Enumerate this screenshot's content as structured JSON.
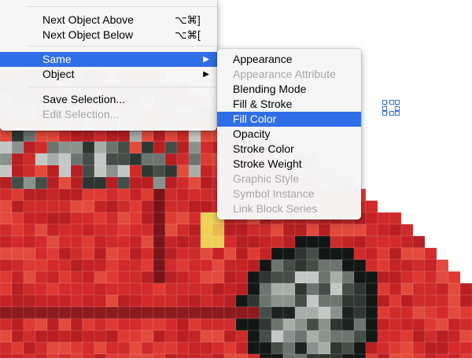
{
  "main_menu": {
    "items": [
      {
        "label": "Next Object Above",
        "shortcut": "⌥⌘]"
      },
      {
        "label": "Next Object Below",
        "shortcut": "⌥⌘["
      },
      {
        "label": "Same",
        "submenu": true,
        "highlighted": true
      },
      {
        "label": "Object",
        "submenu": true
      },
      {
        "label": "Save Selection..."
      },
      {
        "label": "Edit Selection...",
        "disabled": true
      }
    ]
  },
  "same_submenu": {
    "items": [
      {
        "label": "Appearance"
      },
      {
        "label": "Appearance Attribute",
        "disabled": true
      },
      {
        "label": "Blending Mode"
      },
      {
        "label": "Fill & Stroke"
      },
      {
        "label": "Fill Color",
        "highlighted": true
      },
      {
        "label": "Opacity"
      },
      {
        "label": "Stroke Color"
      },
      {
        "label": "Stroke Weight"
      },
      {
        "label": "Graphic Style",
        "disabled": true
      },
      {
        "label": "Symbol Instance",
        "disabled": true
      },
      {
        "label": "Link Block Series",
        "disabled": true
      }
    ]
  },
  "colors": {
    "highlight": "#2f6ee6",
    "disabled_text": "#a6a6a6",
    "canvas_red": "#d42a2c",
    "selection_blue": "#3b6fe0"
  },
  "submenu_arrow": "▶"
}
